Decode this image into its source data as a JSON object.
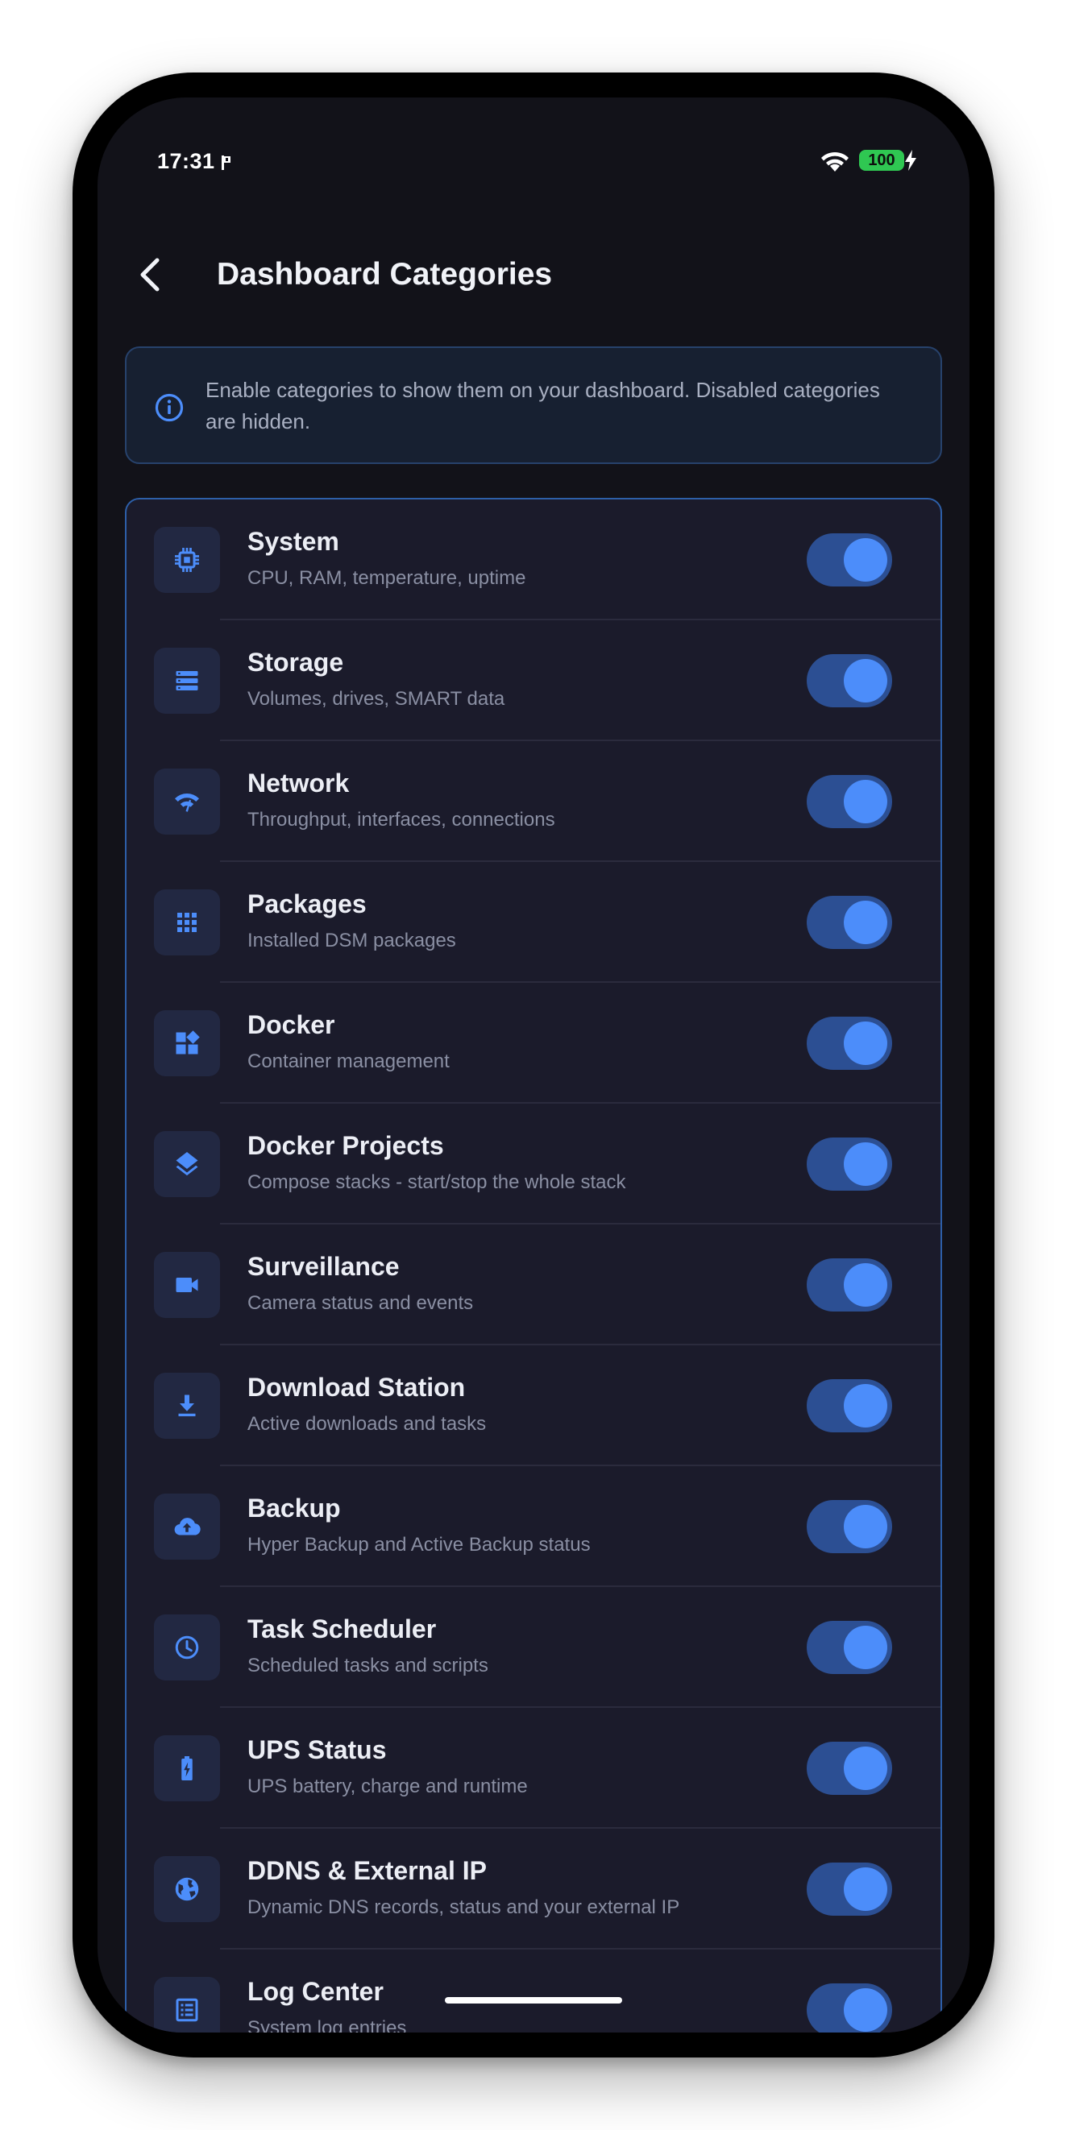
{
  "status_bar": {
    "time": "17:31",
    "battery": "100",
    "icons": [
      "flag-icon",
      "wifi-icon",
      "battery-icon",
      "charging-bolt-icon"
    ]
  },
  "header": {
    "back_icon": "chevron-left-icon",
    "title": "Dashboard Categories"
  },
  "info": {
    "icon": "info-icon",
    "text": "Enable categories to show them on your dashboard. Disabled categories are hidden."
  },
  "categories": [
    {
      "title": "System",
      "subtitle": "CPU, RAM, temperature, uptime",
      "icon": "cpu-icon",
      "enabled": true
    },
    {
      "title": "Storage",
      "subtitle": "Volumes, drives, SMART data",
      "icon": "storage-icon",
      "enabled": true
    },
    {
      "title": "Network",
      "subtitle": "Throughput, interfaces, connections",
      "icon": "network-icon",
      "enabled": true
    },
    {
      "title": "Packages",
      "subtitle": "Installed DSM packages",
      "icon": "apps-grid-icon",
      "enabled": true
    },
    {
      "title": "Docker",
      "subtitle": "Container management",
      "icon": "widgets-icon",
      "enabled": true
    },
    {
      "title": "Docker Projects",
      "subtitle": "Compose stacks - start/stop the whole stack",
      "icon": "layers-icon",
      "enabled": true
    },
    {
      "title": "Surveillance",
      "subtitle": "Camera status and events",
      "icon": "videocam-icon",
      "enabled": true
    },
    {
      "title": "Download Station",
      "subtitle": "Active downloads and tasks",
      "icon": "download-icon",
      "enabled": true
    },
    {
      "title": "Backup",
      "subtitle": "Hyper Backup and Active Backup status",
      "icon": "cloud-upload-icon",
      "enabled": true
    },
    {
      "title": "Task Scheduler",
      "subtitle": "Scheduled tasks and scripts",
      "icon": "clock-icon",
      "enabled": true
    },
    {
      "title": "UPS Status",
      "subtitle": "UPS battery, charge and runtime",
      "icon": "battery-charging-icon",
      "enabled": true
    },
    {
      "title": "DDNS & External IP",
      "subtitle": "Dynamic DNS records, status and your external IP",
      "icon": "globe-icon",
      "enabled": true
    },
    {
      "title": "Log Center",
      "subtitle": "System log entries",
      "icon": "log-list-icon",
      "enabled": true
    }
  ],
  "colors": {
    "accent": "#4c8dfa",
    "toggle_track": "#2c4f93",
    "background": "#121219",
    "card": "#1b1b2b"
  }
}
